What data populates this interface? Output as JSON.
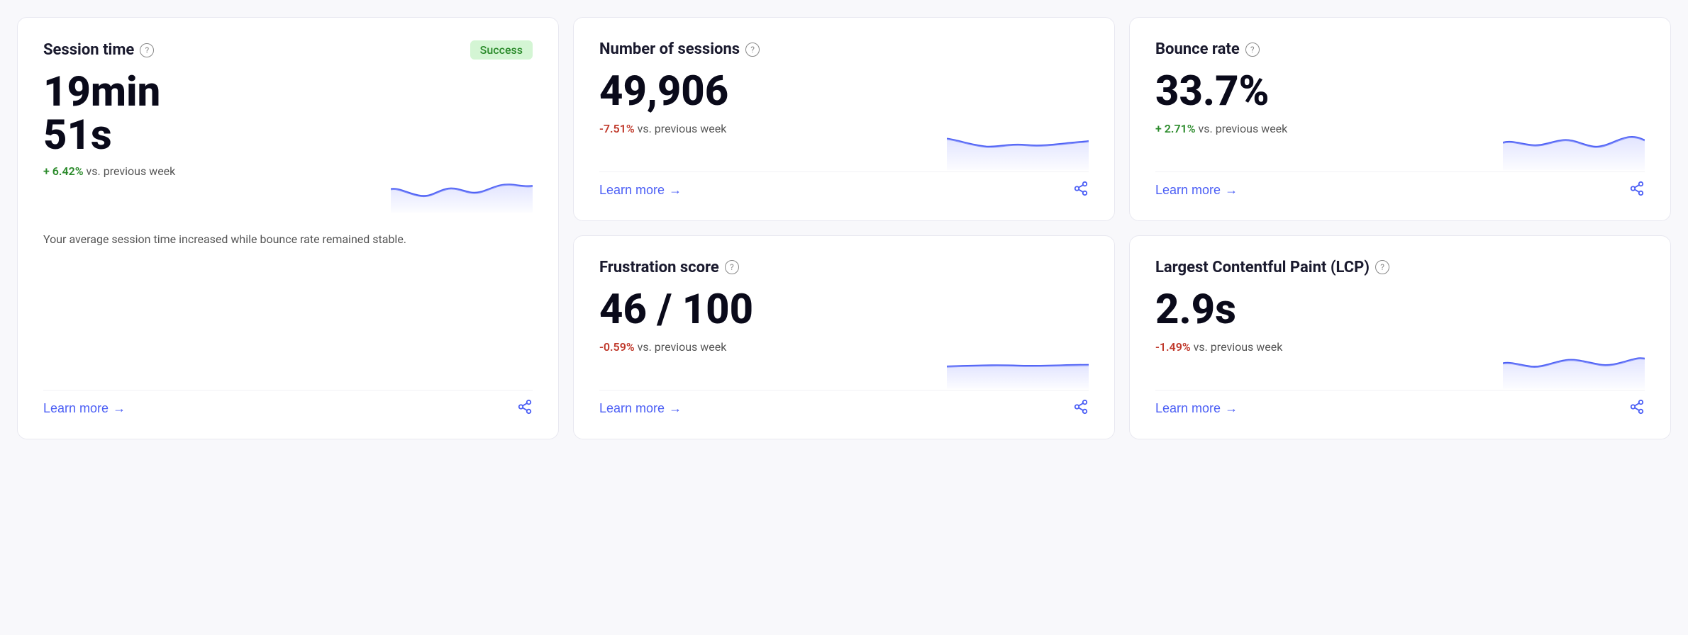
{
  "cards": [
    {
      "id": "session-time",
      "title": "Session time",
      "badge": "Success",
      "hasBadge": true,
      "value": "19min\n51s",
      "valueLines": [
        "19min",
        "51s"
      ],
      "change": "+ 6.42%",
      "changeType": "positive",
      "changeLabel": " vs. previous week",
      "description": "Your average session time increased while bounce rate remained stable.",
      "learnMore": "Learn more",
      "sparkline": "session",
      "spans2rows": true
    },
    {
      "id": "number-of-sessions",
      "title": "Number of sessions",
      "badge": null,
      "hasBadge": false,
      "value": "49,906",
      "valueLines": [
        "49,906"
      ],
      "change": "-7.51%",
      "changeType": "negative",
      "changeLabel": " vs. previous week",
      "description": null,
      "learnMore": "Learn more",
      "sparkline": "sessions"
    },
    {
      "id": "bounce-rate",
      "title": "Bounce rate",
      "badge": null,
      "hasBadge": false,
      "value": "33.7%",
      "valueLines": [
        "33.7%"
      ],
      "change": "+ 2.71%",
      "changeType": "positive",
      "changeLabel": " vs. previous week",
      "description": null,
      "learnMore": "Learn more",
      "sparkline": "bounce"
    },
    {
      "id": "frustration-score",
      "title": "Frustration score",
      "badge": null,
      "hasBadge": false,
      "value": "46 / 100",
      "valueLines": [
        "46 / 100"
      ],
      "change": "-0.59%",
      "changeType": "negative",
      "changeLabel": " vs. previous week",
      "description": null,
      "learnMore": "Learn more",
      "sparkline": "frustration"
    },
    {
      "id": "lcp",
      "title": "Largest Contentful Paint (LCP)",
      "badge": null,
      "hasBadge": false,
      "value": "2.9s",
      "valueLines": [
        "2.9s"
      ],
      "change": "-1.49%",
      "changeType": "negative",
      "changeLabel": " vs. previous week",
      "description": null,
      "learnMore": "Learn more",
      "sparkline": "lcp"
    }
  ]
}
